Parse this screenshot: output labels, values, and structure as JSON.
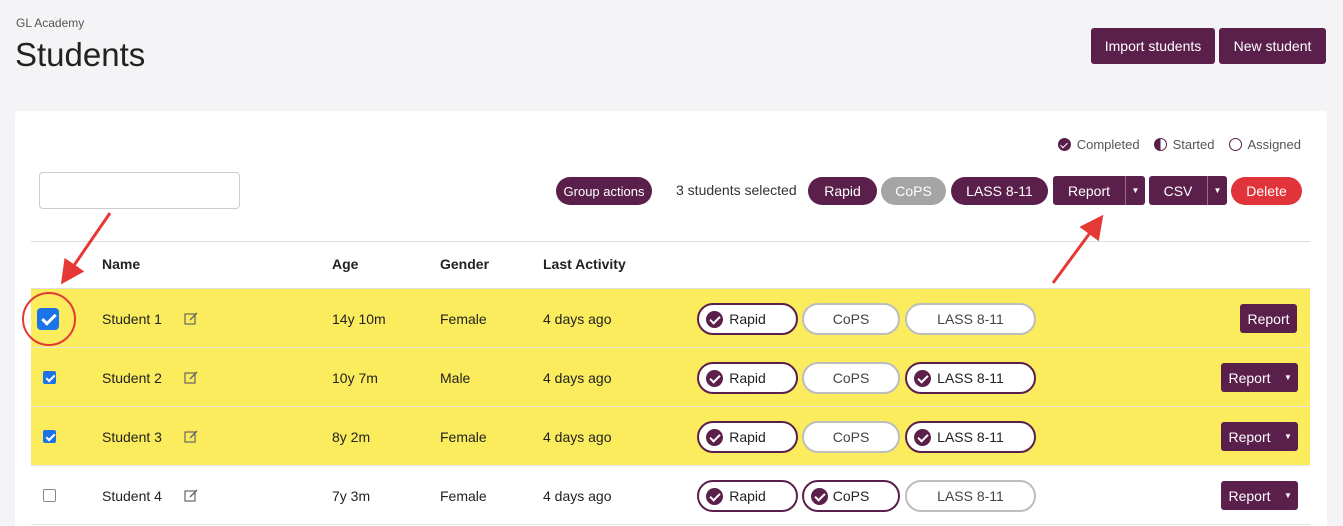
{
  "org": "GL Academy",
  "title": "Students",
  "header": {
    "import_label": "Import students",
    "new_label": "New student"
  },
  "legend": {
    "completed": "Completed",
    "started": "Started",
    "assigned": "Assigned"
  },
  "search": {
    "value": "",
    "placeholder": ""
  },
  "toolbar": {
    "group_actions": "Group actions",
    "selected_text": "3 students selected",
    "rapid": "Rapid",
    "cops": "CoPS",
    "lass": "LASS 8-11",
    "report": "Report",
    "csv": "CSV",
    "delete": "Delete"
  },
  "columns": {
    "name": "Name",
    "age": "Age",
    "gender": "Gender",
    "last_activity": "Last Activity"
  },
  "rows": [
    {
      "name": "Student 1",
      "age": "14y 10m",
      "gender": "Female",
      "last": "4 days ago",
      "selected": true,
      "tests": [
        {
          "label": "Rapid",
          "status": "completed"
        },
        {
          "label": "CoPS",
          "status": "none"
        },
        {
          "label": "LASS 8-11",
          "status": "none"
        }
      ],
      "report": "Report"
    },
    {
      "name": "Student 2",
      "age": "10y 7m",
      "gender": "Male",
      "last": "4 days ago",
      "selected": true,
      "tests": [
        {
          "label": "Rapid",
          "status": "completed"
        },
        {
          "label": "CoPS",
          "status": "none"
        },
        {
          "label": "LASS 8-11",
          "status": "completed"
        }
      ],
      "report": "Report"
    },
    {
      "name": "Student 3",
      "age": "8y 2m",
      "gender": "Female",
      "last": "4 days ago",
      "selected": true,
      "tests": [
        {
          "label": "Rapid",
          "status": "completed"
        },
        {
          "label": "CoPS",
          "status": "none"
        },
        {
          "label": "LASS 8-11",
          "status": "completed"
        }
      ],
      "report": "Report"
    },
    {
      "name": "Student 4",
      "age": "7y 3m",
      "gender": "Female",
      "last": "4 days ago",
      "selected": false,
      "tests": [
        {
          "label": "Rapid",
          "status": "completed"
        },
        {
          "label": "CoPS",
          "status": "completed"
        },
        {
          "label": "LASS 8-11",
          "status": "none"
        }
      ],
      "report": "Report"
    }
  ],
  "colors": {
    "brand": "#5a1f4a",
    "highlight": "#fbec5d",
    "danger": "#e0343a",
    "annotation": "#e53935"
  }
}
